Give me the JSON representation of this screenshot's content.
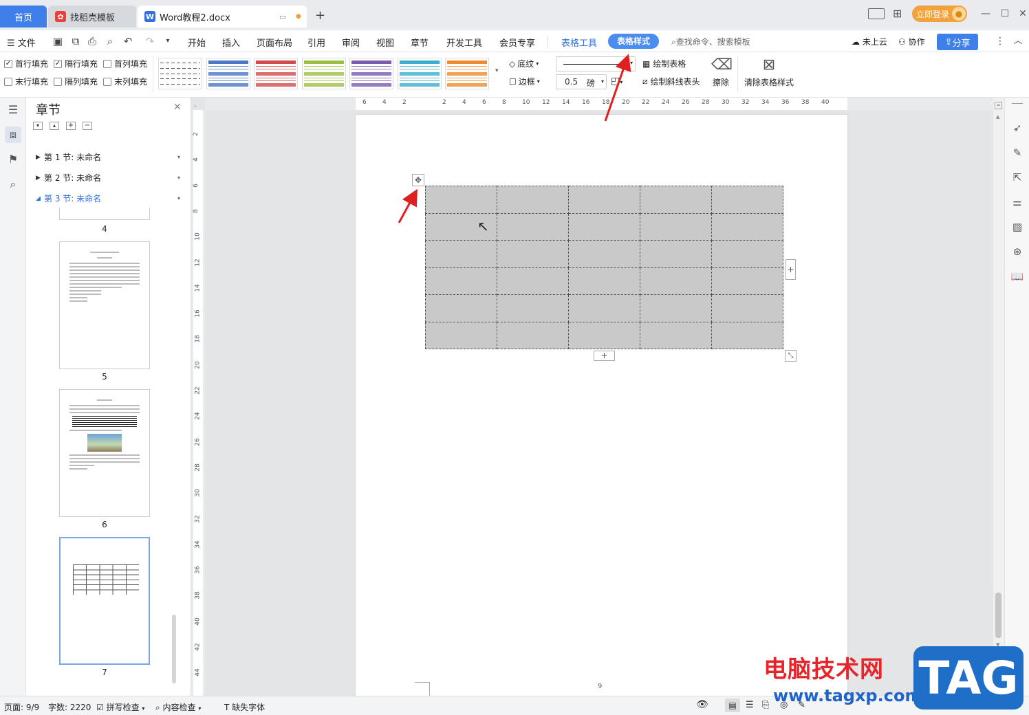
{
  "titlebar": {
    "tabs": [
      {
        "label": "首页"
      },
      {
        "label": "找稻壳模板"
      },
      {
        "label": "Word教程2.docx"
      }
    ],
    "login": "立即登录",
    "new_tab": "+"
  },
  "menubar": {
    "file": "文件",
    "items": [
      "开始",
      "插入",
      "页面布局",
      "引用",
      "审阅",
      "视图",
      "章节",
      "开发工具",
      "会员专享"
    ],
    "table_tools": "表格工具",
    "table_style": "表格样式",
    "search": "查找命令、搜索模板",
    "cloud": "未上云",
    "collab": "协作",
    "share": "分享"
  },
  "ribbon": {
    "checks": [
      {
        "label": "首行填充",
        "checked": true
      },
      {
        "label": "隔行填充",
        "checked": true
      },
      {
        "label": "首列填充",
        "checked": false
      },
      {
        "label": "末行填充",
        "checked": false
      },
      {
        "label": "隔列填充",
        "checked": false
      },
      {
        "label": "末列填充",
        "checked": false
      }
    ],
    "style_colors": [
      "#888888",
      "#4a78c6",
      "#d24a4a",
      "#9cbf3f",
      "#7b5ab0",
      "#3aaed0",
      "#f08a30"
    ],
    "shading": "底纹",
    "border": "边框",
    "line_width": "0.5",
    "line_unit": "磅",
    "draw_table": "绘制表格",
    "draw_diag": "绘制斜线表头",
    "erase": "擦除",
    "clear_style": "清除表格样式"
  },
  "panel": {
    "title": "章节",
    "sections": [
      {
        "label": "第 1 节: 未命名"
      },
      {
        "label": "第 2 节: 未命名"
      },
      {
        "label": "第 3 节: 未命名"
      }
    ],
    "pages": [
      "4",
      "5",
      "6",
      "7"
    ]
  },
  "ruler": {
    "h_ticks": [
      "6",
      "4",
      "2",
      "2",
      "4",
      "6",
      "8",
      "10",
      "12",
      "14",
      "16",
      "18",
      "20",
      "22",
      "24",
      "26",
      "28",
      "30",
      "32",
      "34",
      "36",
      "38",
      "40"
    ],
    "v_ticks": [
      "2",
      "4",
      "6",
      "8",
      "10",
      "12",
      "14",
      "16",
      "18",
      "20",
      "22",
      "24",
      "26",
      "28",
      "30",
      "32",
      "34",
      "36",
      "38",
      "40",
      "42",
      "44"
    ]
  },
  "document": {
    "table_rows": 6,
    "table_cols": 5,
    "page_number": "9"
  },
  "statusbar": {
    "page": "页面: 9/9",
    "words": "字数: 2220",
    "spell": "拼写检查",
    "content": "内容检查",
    "fonts": "缺失字体"
  },
  "watermark": {
    "text": "电脑技术网",
    "url": "www.tagxp.com",
    "tag": "TAG"
  }
}
